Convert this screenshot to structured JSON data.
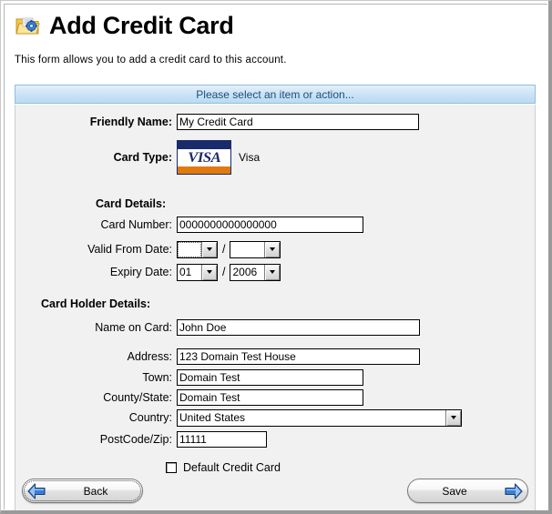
{
  "window": {
    "title": "Add Credit Card",
    "subtitle": "This form allows you to add a credit card to this account.",
    "icon": "folder-settings-icon"
  },
  "banner": {
    "text": "Please select an item or action..."
  },
  "form": {
    "friendly_name": {
      "label": "Friendly Name:",
      "value": "My Credit Card",
      "placeholder": ""
    },
    "card_type": {
      "label": "Card Type:",
      "logo_text": "VISA",
      "value": "Visa",
      "logo_colors": {
        "navy": "#1a2b6b",
        "orange": "#e07a10"
      }
    },
    "card_details_heading": "Card Details:",
    "card_number": {
      "label": "Card Number:",
      "value": "0000000000000000",
      "placeholder": ""
    },
    "valid_from": {
      "label": "Valid From Date:",
      "month": "",
      "year": "",
      "separator": "/"
    },
    "expiry": {
      "label": "Expiry Date:",
      "month": "01",
      "year": "2006",
      "separator": "/"
    },
    "card_holder_heading": "Card Holder Details:",
    "name_on_card": {
      "label": "Name on Card:",
      "value": "John Doe",
      "placeholder": ""
    },
    "address": {
      "label": "Address:",
      "value": "123 Domain Test House",
      "placeholder": ""
    },
    "town": {
      "label": "Town:",
      "value": "Domain Test",
      "placeholder": ""
    },
    "county_state": {
      "label": "County/State:",
      "value": "Domain Test",
      "placeholder": ""
    },
    "country": {
      "label": "Country:",
      "value": "United States"
    },
    "postcode": {
      "label": "PostCode/Zip:",
      "value": "11111",
      "placeholder": ""
    },
    "default_card": {
      "label": "Default Credit Card",
      "checked": "false"
    }
  },
  "footer": {
    "back_label": "Back",
    "save_label": "Save"
  },
  "colors": {
    "banner_text": "#1c4e7c",
    "banner_border": "#8fbedd",
    "panel_bg": "#f1f1f1",
    "arrow_blue": "#2f6fd0"
  }
}
